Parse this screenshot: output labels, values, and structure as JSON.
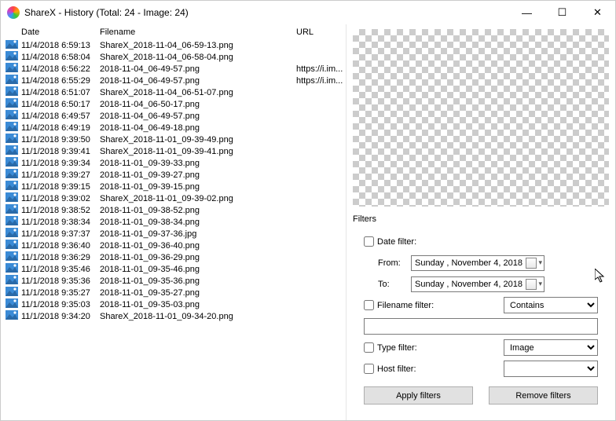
{
  "window": {
    "title": "ShareX - History (Total: 24 - Image: 24)",
    "minimize": "—",
    "maximize": "☐",
    "close": "✕"
  },
  "columns": {
    "date": "Date",
    "filename": "Filename",
    "url": "URL"
  },
  "rows": [
    {
      "date": "11/4/2018 6:59:13",
      "file": "ShareX_2018-11-04_06-59-13.png",
      "url": ""
    },
    {
      "date": "11/4/2018 6:58:04",
      "file": "ShareX_2018-11-04_06-58-04.png",
      "url": ""
    },
    {
      "date": "11/4/2018 6:56:22",
      "file": "2018-11-04_06-49-57.png",
      "url": "https://i.im..."
    },
    {
      "date": "11/4/2018 6:55:29",
      "file": "2018-11-04_06-49-57.png",
      "url": "https://i.im..."
    },
    {
      "date": "11/4/2018 6:51:07",
      "file": "ShareX_2018-11-04_06-51-07.png",
      "url": ""
    },
    {
      "date": "11/4/2018 6:50:17",
      "file": "2018-11-04_06-50-17.png",
      "url": ""
    },
    {
      "date": "11/4/2018 6:49:57",
      "file": "2018-11-04_06-49-57.png",
      "url": ""
    },
    {
      "date": "11/4/2018 6:49:19",
      "file": "2018-11-04_06-49-18.png",
      "url": ""
    },
    {
      "date": "11/1/2018 9:39:50",
      "file": "ShareX_2018-11-01_09-39-49.png",
      "url": ""
    },
    {
      "date": "11/1/2018 9:39:41",
      "file": "ShareX_2018-11-01_09-39-41.png",
      "url": ""
    },
    {
      "date": "11/1/2018 9:39:34",
      "file": "2018-11-01_09-39-33.png",
      "url": ""
    },
    {
      "date": "11/1/2018 9:39:27",
      "file": "2018-11-01_09-39-27.png",
      "url": ""
    },
    {
      "date": "11/1/2018 9:39:15",
      "file": "2018-11-01_09-39-15.png",
      "url": ""
    },
    {
      "date": "11/1/2018 9:39:02",
      "file": "ShareX_2018-11-01_09-39-02.png",
      "url": ""
    },
    {
      "date": "11/1/2018 9:38:52",
      "file": "2018-11-01_09-38-52.png",
      "url": ""
    },
    {
      "date": "11/1/2018 9:38:34",
      "file": "2018-11-01_09-38-34.png",
      "url": ""
    },
    {
      "date": "11/1/2018 9:37:37",
      "file": "2018-11-01_09-37-36.jpg",
      "url": ""
    },
    {
      "date": "11/1/2018 9:36:40",
      "file": "2018-11-01_09-36-40.png",
      "url": ""
    },
    {
      "date": "11/1/2018 9:36:29",
      "file": "2018-11-01_09-36-29.png",
      "url": ""
    },
    {
      "date": "11/1/2018 9:35:46",
      "file": "2018-11-01_09-35-46.png",
      "url": ""
    },
    {
      "date": "11/1/2018 9:35:36",
      "file": "2018-11-01_09-35-36.png",
      "url": ""
    },
    {
      "date": "11/1/2018 9:35:27",
      "file": "2018-11-01_09-35-27.png",
      "url": ""
    },
    {
      "date": "11/1/2018 9:35:03",
      "file": "2018-11-01_09-35-03.png",
      "url": ""
    },
    {
      "date": "11/1/2018 9:34:20",
      "file": "ShareX_2018-11-01_09-34-20.png",
      "url": ""
    }
  ],
  "filters": {
    "heading": "Filters",
    "date_filter": "Date filter:",
    "from": "From:",
    "to": "To:",
    "date_from": "Sunday   , November   4, 2018",
    "date_to": "Sunday   , November   4, 2018",
    "filename_filter": "Filename filter:",
    "filename_mode": "Contains",
    "filename_value": "",
    "type_filter": "Type filter:",
    "type_value": "Image",
    "host_filter": "Host filter:",
    "host_value": "",
    "apply": "Apply filters",
    "remove": "Remove filters"
  }
}
